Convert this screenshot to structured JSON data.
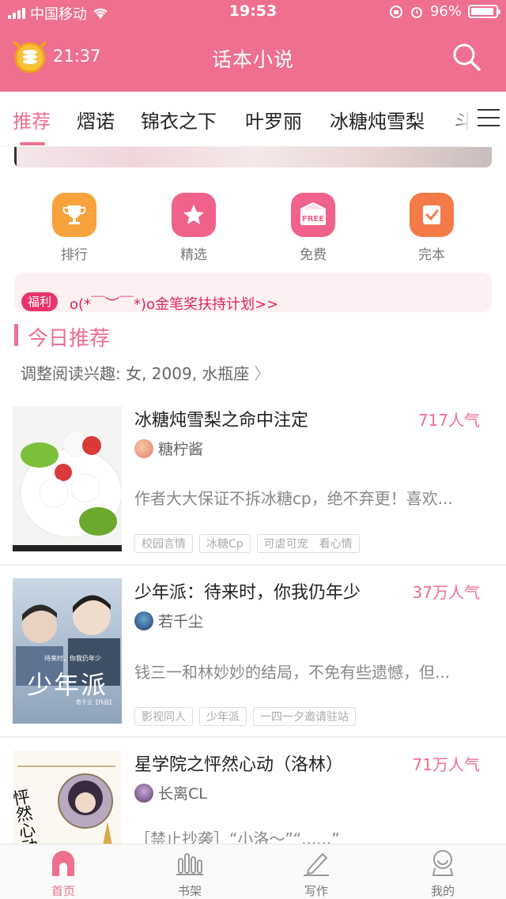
{
  "status_bar": {
    "carrier": "中国移动",
    "time": "19:53",
    "battery": "96%"
  },
  "header": {
    "timer": "21:37",
    "title": "话本小说"
  },
  "tabs": [
    {
      "label": "推荐"
    },
    {
      "label": "熠诺"
    },
    {
      "label": "锦衣之下"
    },
    {
      "label": "叶罗丽"
    },
    {
      "label": "冰糖炖雪梨"
    },
    {
      "label": "斗"
    }
  ],
  "quick_links": [
    {
      "label": "排行",
      "icon": "trophy-icon",
      "color": "#f7a23a"
    },
    {
      "label": "精选",
      "icon": "star-icon",
      "color": "#f0628a"
    },
    {
      "label": "免费",
      "icon": "free-icon",
      "color": "#f0628a"
    },
    {
      "label": "完本",
      "icon": "check-icon",
      "color": "#f47a48"
    }
  ],
  "notice": {
    "badge": "福利",
    "text": "o(*￣︶￣*)o金笔奖扶持计划>>"
  },
  "section": {
    "title": "今日推荐",
    "preference": "调整阅读兴趣: 女, 2009, 水瓶座"
  },
  "books": [
    {
      "title": "冰糖炖雪梨之命中注定",
      "popularity": "717人气",
      "author": "糖柠酱",
      "desc": "作者大大保证不拆冰糖cp，绝不弃更！喜欢...",
      "tags": [
        "校园言情",
        "冰糖Cp",
        "可虐可宠　看心情"
      ]
    },
    {
      "title": "少年派：待来时，你我仍年少",
      "popularity": "37万人气",
      "author": "若千尘",
      "desc": "钱三一和林妙妙的结局，不免有些遗憾，但...",
      "tags": [
        "影视同人",
        "少年派",
        "一四一夕邀请驻站"
      ],
      "cover_text": {
        "tagline": "待来时，你我仍年少",
        "title": "少年派",
        "author": "若千尘【作品】"
      }
    },
    {
      "title": "星学院之怦然心动（洛林）",
      "popularity": "71万人气",
      "author": "长离CL",
      "desc": "［禁止抄袭］“小洛～”“......”",
      "tags": [],
      "cover_text": {
        "title": "怦然心动"
      }
    }
  ],
  "bottom_nav": [
    {
      "label": "首页",
      "active": true
    },
    {
      "label": "书架",
      "active": false
    },
    {
      "label": "写作",
      "active": false
    },
    {
      "label": "我的",
      "active": false
    }
  ]
}
